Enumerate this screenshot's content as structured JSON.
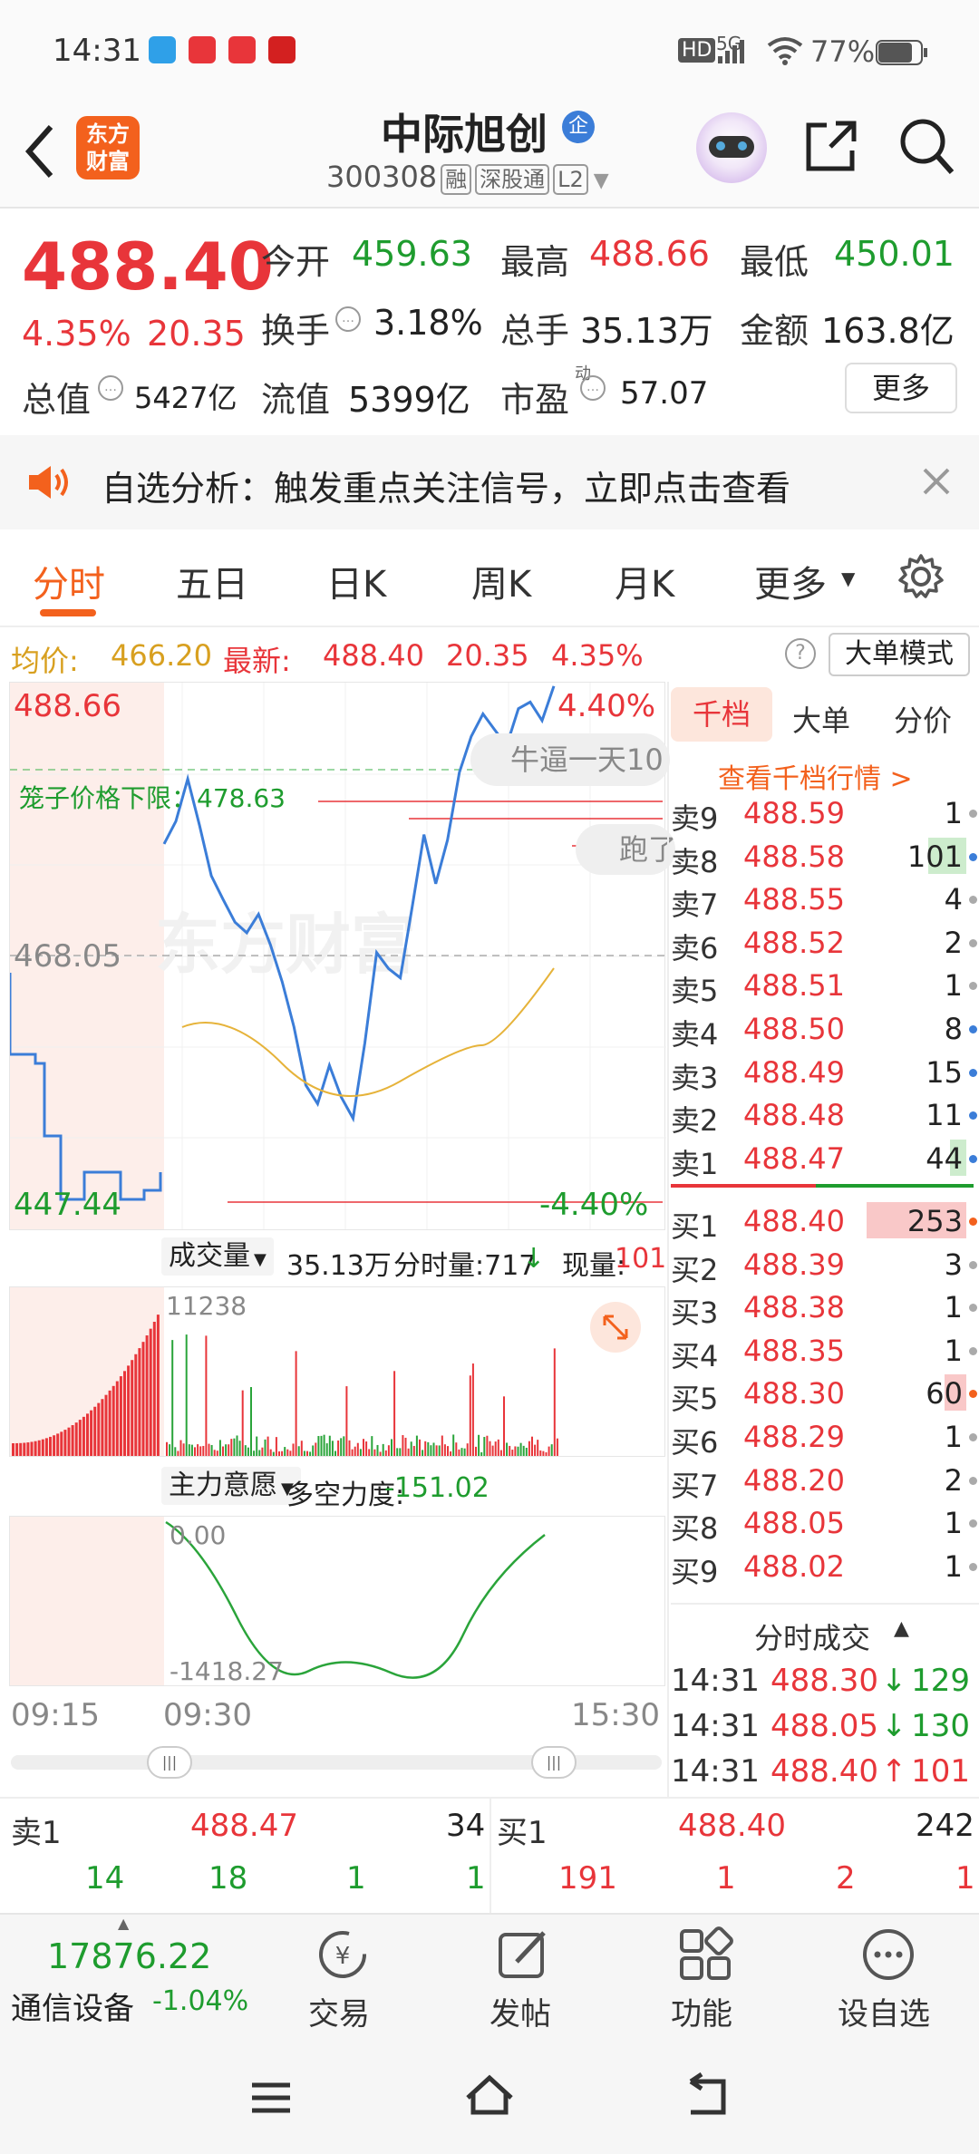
{
  "status": {
    "time": "14:31",
    "battery": "77%",
    "net": "5G"
  },
  "header": {
    "title": "中际旭创",
    "title_badge": "企",
    "code": "300308",
    "tags": [
      "融",
      "深股通",
      "L2"
    ],
    "logo": "东方财富"
  },
  "quote": {
    "price": "488.40",
    "change_pct": "4.35%",
    "change": "20.35",
    "open_label": "今开",
    "open": "459.63",
    "high_label": "最高",
    "high": "488.66",
    "low_label": "最低",
    "low": "450.01",
    "turnover_label": "换手",
    "turnover": "3.18%",
    "volume_label": "总手",
    "volume": "35.13万",
    "amount_label": "金额",
    "amount": "163.8亿",
    "mktcap_label": "总值",
    "mktcap": "5427亿",
    "float_label": "流值",
    "float": "5399亿",
    "pe_label": "市盈",
    "pe_sup": "动",
    "pe": "57.07",
    "more": "更多"
  },
  "notice": {
    "text": "自选分析：触发重点关注信号，立即点击查看"
  },
  "tabs": [
    "分时",
    "五日",
    "日K",
    "周K",
    "月K",
    "更多"
  ],
  "chartbar": {
    "avg_label": "均价:",
    "avg": "466.20",
    "latest_label": "最新:",
    "latest": "488.40",
    "chg": "20.35",
    "pct": "4.35%",
    "mode": "大单模式"
  },
  "chart": {
    "high": "488.66",
    "mid": "468.05",
    "low": "447.44",
    "pct_hi": "4.40%",
    "pct_lo": "-4.40%",
    "cage_label": "笼子价格下限：478.63",
    "watermark": "东方财富",
    "bubble1": "牛逼一天10",
    "bubble2": "跑了",
    "vol_label": "成交量",
    "vol_total": "35.13万",
    "fen_label": "分时量:717",
    "fen_arrow": "↓",
    "cur_label": "现量:",
    "cur": "101",
    "vol_max": "11238",
    "flow_label": "主力意愿",
    "dk_label": "多空力度:",
    "dk": "-151.02",
    "flow_top": "0.00",
    "flow_bot": "-1418.27",
    "t_start": "09:15",
    "t_open": "09:30",
    "t_end": "15:30"
  },
  "chart_data": {
    "type": "line",
    "series": [
      {
        "values": [
          476.5,
          478.2,
          481.4,
          477.9,
          474.1,
          472.3,
          470.6,
          469.8,
          471.2,
          468.9,
          466.1,
          462.7,
          458.3,
          456.9,
          459.8,
          457.4,
          455.8,
          461.5,
          468.3,
          467.1,
          466.4,
          471.7,
          477.2,
          473.5,
          476.8,
          481.9,
          484.6,
          486.3,
          485.1,
          483.9,
          486.7,
          487.2,
          485.8,
          488.4
        ]
      }
    ],
    "ylim": [
      447.44,
      488.66
    ]
  },
  "orderbook": {
    "tabs": [
      "千档",
      "大单",
      "分价"
    ],
    "link": "查看千档行情 >",
    "asks": [
      {
        "n": "卖9",
        "p": "488.59",
        "v": "1"
      },
      {
        "n": "卖8",
        "p": "488.58",
        "v": "101"
      },
      {
        "n": "卖7",
        "p": "488.55",
        "v": "4"
      },
      {
        "n": "卖6",
        "p": "488.52",
        "v": "2"
      },
      {
        "n": "卖5",
        "p": "488.51",
        "v": "1"
      },
      {
        "n": "卖4",
        "p": "488.50",
        "v": "8"
      },
      {
        "n": "卖3",
        "p": "488.49",
        "v": "15"
      },
      {
        "n": "卖2",
        "p": "488.48",
        "v": "11"
      },
      {
        "n": "卖1",
        "p": "488.47",
        "v": "44"
      }
    ],
    "bids": [
      {
        "n": "买1",
        "p": "488.40",
        "v": "253"
      },
      {
        "n": "买2",
        "p": "488.39",
        "v": "3"
      },
      {
        "n": "买3",
        "p": "488.38",
        "v": "1"
      },
      {
        "n": "买4",
        "p": "488.35",
        "v": "1"
      },
      {
        "n": "买5",
        "p": "488.30",
        "v": "60"
      },
      {
        "n": "买6",
        "p": "488.29",
        "v": "1"
      },
      {
        "n": "买7",
        "p": "488.20",
        "v": "2"
      },
      {
        "n": "买8",
        "p": "488.05",
        "v": "1"
      },
      {
        "n": "买9",
        "p": "488.02",
        "v": "1"
      }
    ],
    "trades_label": "分时成交",
    "trades": [
      {
        "t": "14:31",
        "p": "488.30",
        "a": "↓",
        "v": "129"
      },
      {
        "t": "14:31",
        "p": "488.05",
        "a": "↓",
        "v": "130"
      },
      {
        "t": "14:31",
        "p": "488.40",
        "a": "↑",
        "v": "101"
      }
    ]
  },
  "bottom": {
    "sell_label": "卖1",
    "sell_price": "488.47",
    "sell_vol": "34",
    "buy_label": "买1",
    "buy_price": "488.40",
    "buy_vol": "242",
    "sell_q": [
      "14",
      "18",
      "1",
      "1"
    ],
    "buy_q": [
      "191",
      "1",
      "2",
      "1"
    ]
  },
  "nav": {
    "index_value": "17876.22",
    "index_name": "通信设备",
    "index_pct": "-1.04%",
    "items": [
      "交易",
      "发帖",
      "功能",
      "设自选"
    ]
  }
}
